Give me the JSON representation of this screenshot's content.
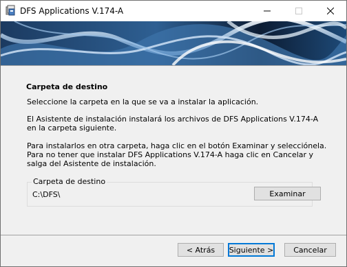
{
  "window": {
    "title": "DFS Applications V.174-A"
  },
  "content": {
    "heading": "Carpeta de destino",
    "paragraph1": "Seleccione la carpeta en la que se va a instalar la aplicación.",
    "paragraph2": "El Asistente de instalación instalará los archivos de DFS Applications V.174-A en la carpeta siguiente.",
    "paragraph3": "Para instalarlos en otra carpeta, haga clic en el botón Examinar y selecciónela.",
    "paragraph4": "Para no tener que instalar DFS Applications V.174-A haga clic en Cancelar y salga del Asistente de instalación.",
    "destination": {
      "group_label": "Carpeta de destino",
      "path": "C:\\DFS\\",
      "browse_label": "Examinar"
    }
  },
  "footer": {
    "back_label": "< Atrás",
    "next_label": "Siguiente >",
    "cancel_label": "Cancelar"
  },
  "colors": {
    "accent": "#0078d7",
    "banner_dark": "#0e2038",
    "banner_light": "#dbe9f8"
  }
}
